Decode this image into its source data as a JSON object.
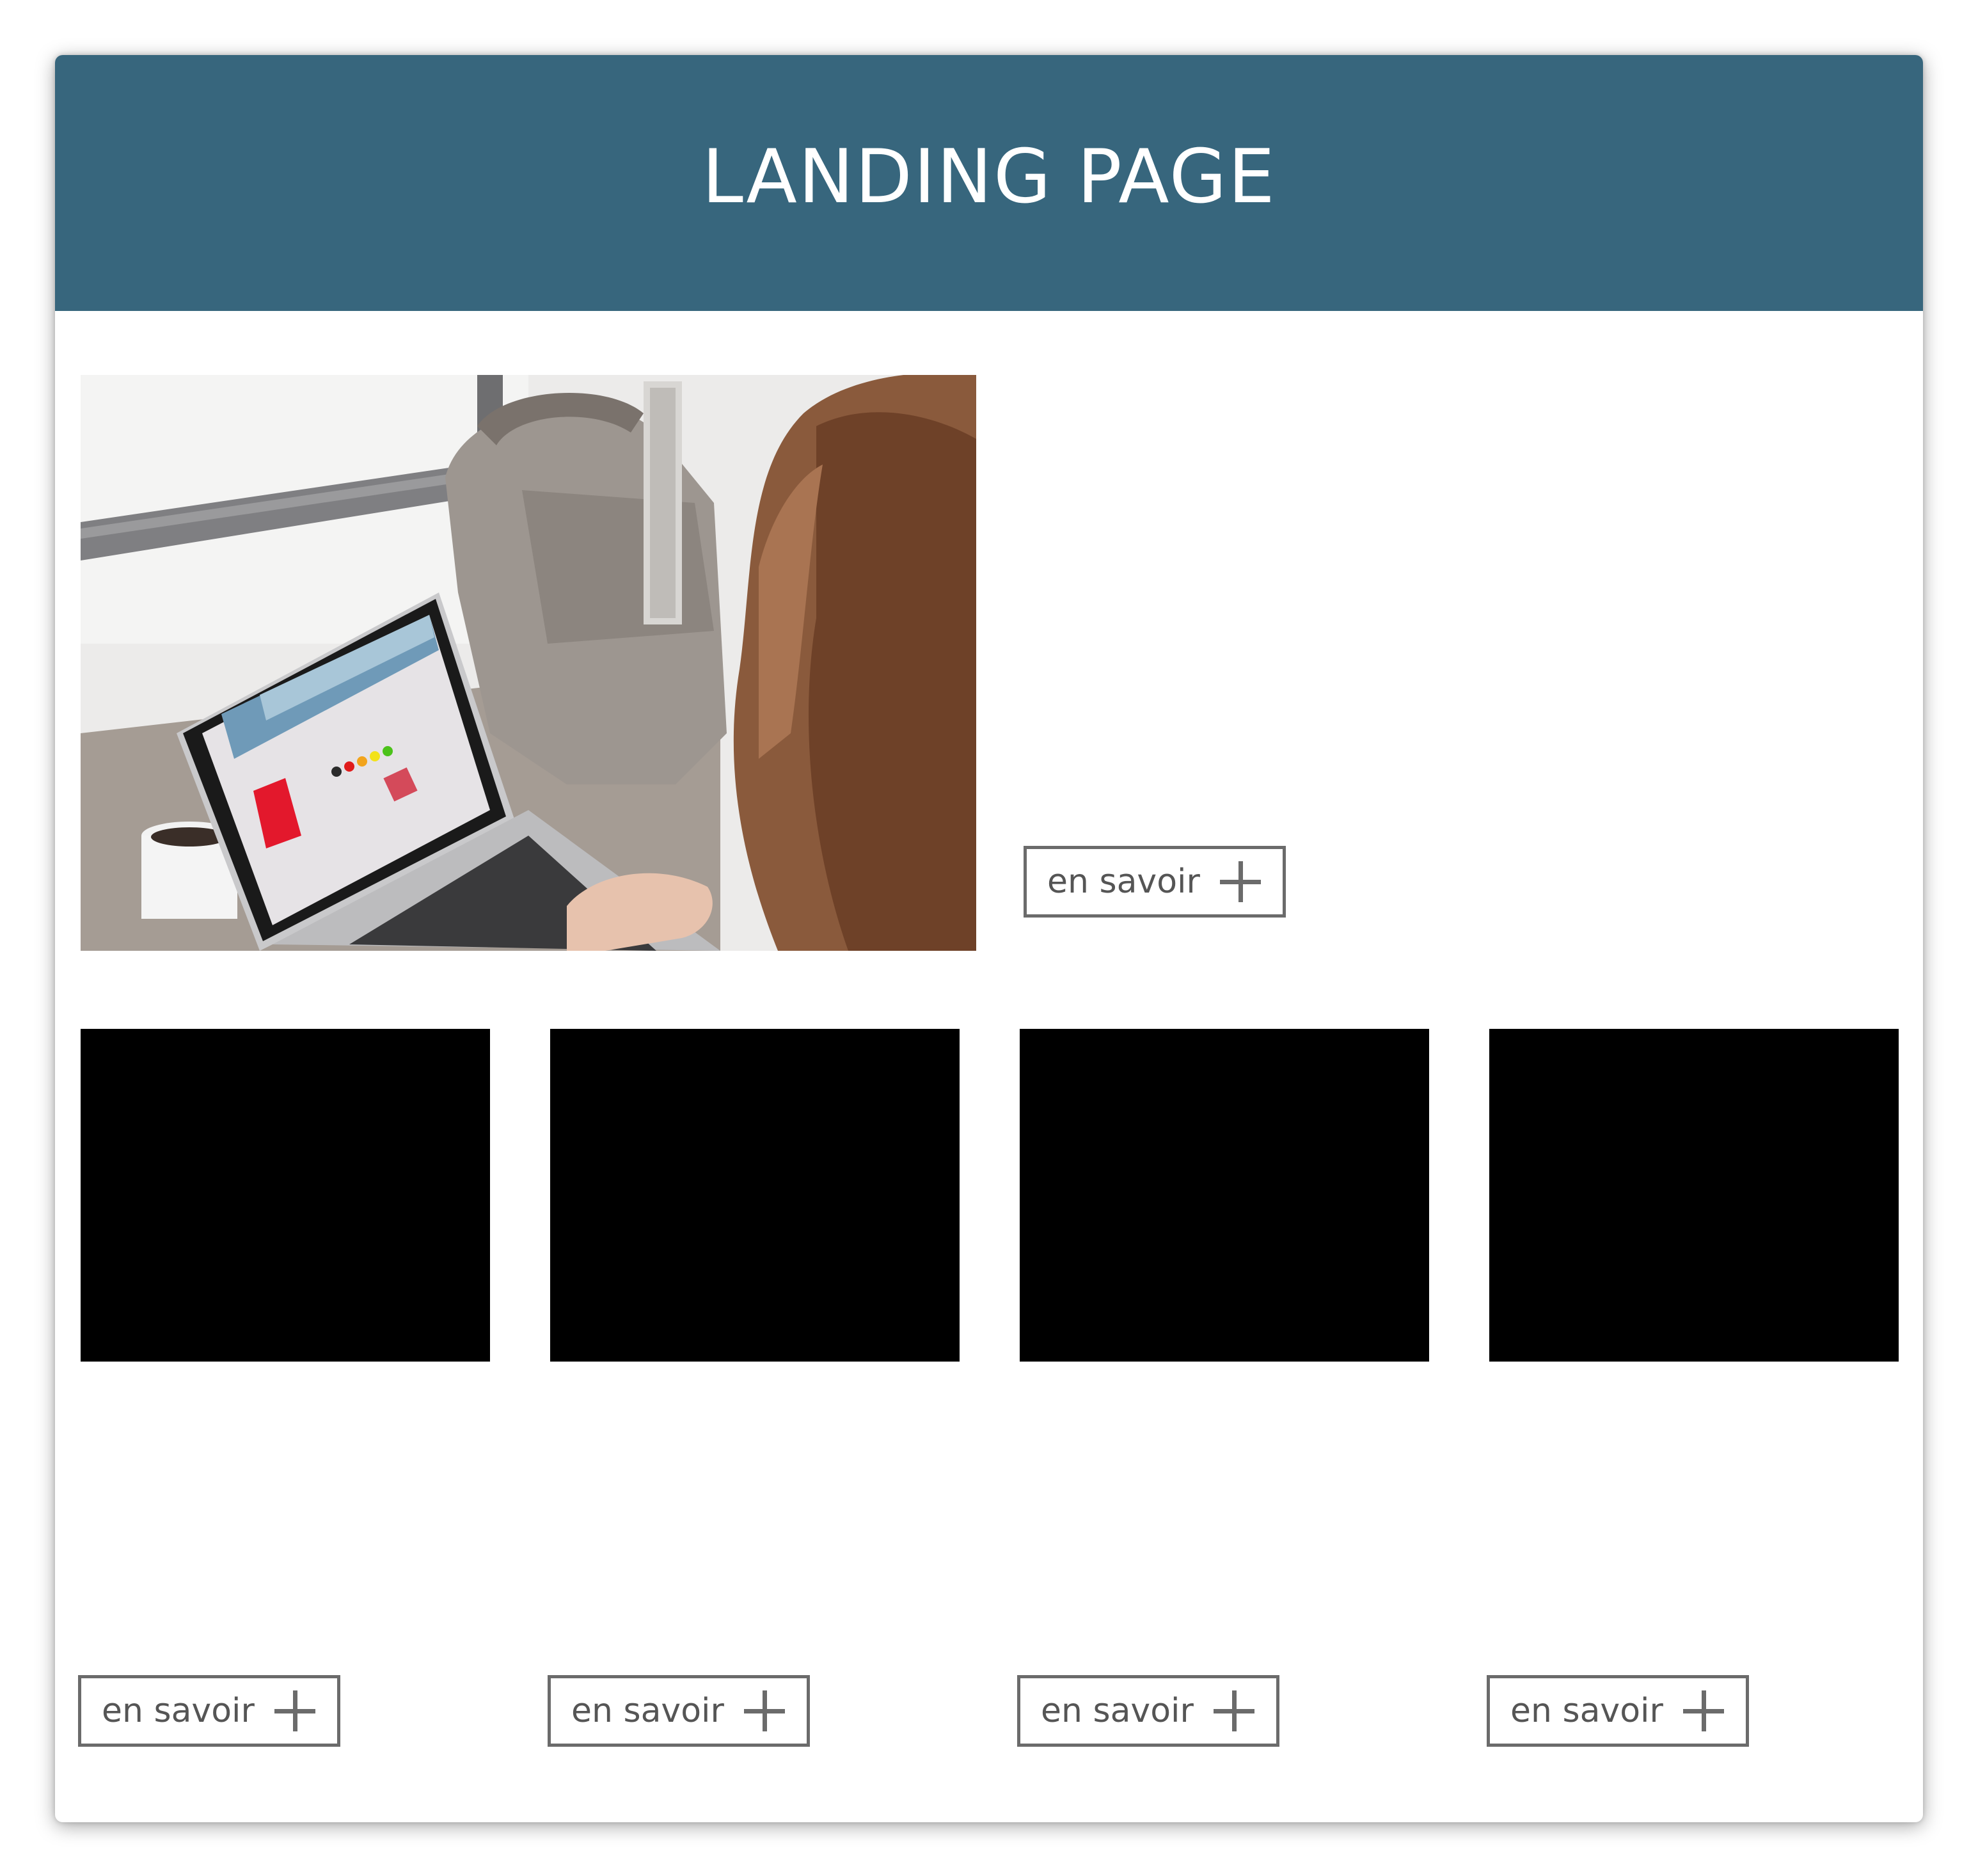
{
  "header": {
    "title": "LANDING PAGE",
    "background_color": "#37667d",
    "text_color": "#ffffff"
  },
  "hero": {
    "image_icon": "photo-woman-laptop-icon",
    "more_button_label": "en savoir",
    "more_button_icon": "plus-icon"
  },
  "cards": [
    {
      "more_button_label": "en savoir",
      "more_button_icon": "plus-icon"
    },
    {
      "more_button_label": "en savoir",
      "more_button_icon": "plus-icon"
    },
    {
      "more_button_label": "en savoir",
      "more_button_icon": "plus-icon"
    },
    {
      "more_button_label": "en savoir",
      "more_button_icon": "plus-icon"
    }
  ],
  "colors": {
    "button_border": "#6b6b6b",
    "button_text": "#555555",
    "placeholder": "#000000"
  }
}
